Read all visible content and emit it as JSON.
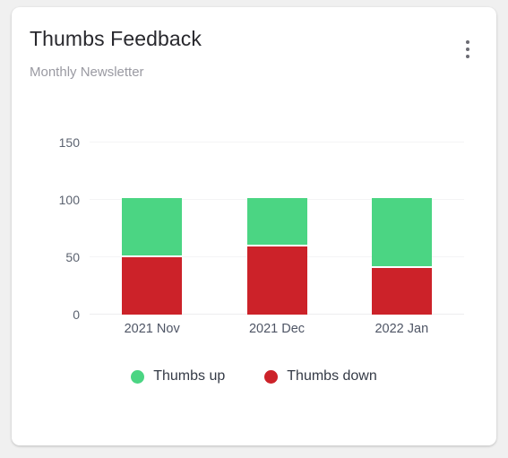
{
  "card": {
    "title": "Thumbs Feedback",
    "subtitle": "Monthly Newsletter",
    "menu_icon": "kebab-menu-icon"
  },
  "chart_data": {
    "type": "bar",
    "stacked": true,
    "title": "Thumbs Feedback",
    "subtitle": "Monthly Newsletter",
    "xlabel": "",
    "ylabel": "",
    "categories": [
      "2021 Nov",
      "2021 Dec",
      "2022 Jan"
    ],
    "series": [
      {
        "name": "Thumbs up",
        "color": "#4bd583",
        "values": [
          50,
          41,
          59
        ]
      },
      {
        "name": "Thumbs down",
        "color": "#cc2229",
        "values": [
          50,
          59,
          41
        ]
      }
    ],
    "stack_order_bottom_to_top": [
      "Thumbs down",
      "Thumbs up"
    ],
    "ylim": [
      0,
      150
    ],
    "yticks": [
      0,
      50,
      100,
      150
    ],
    "ytick_labels": [
      "0",
      "50",
      "100",
      "150"
    ],
    "grid": true,
    "legend_position": "bottom"
  }
}
